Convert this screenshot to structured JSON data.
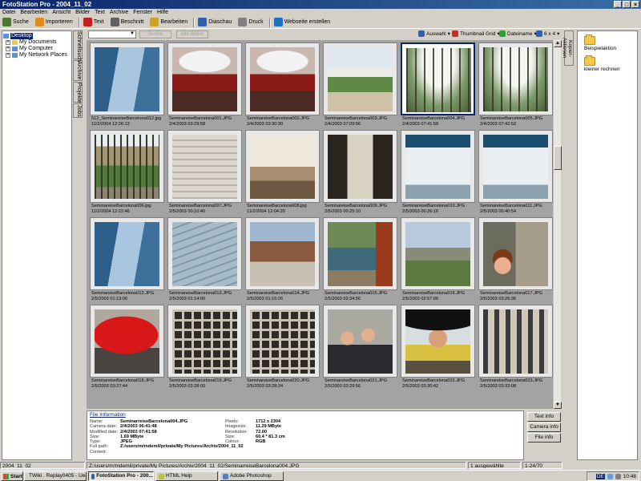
{
  "window": {
    "title": "FotoStation Pro - 2004_11_02",
    "controls": [
      "_",
      "□",
      "×"
    ]
  },
  "menu": [
    "Datei",
    "Bearbeiten",
    "Ansicht",
    "Bilder",
    "Text",
    "Archive",
    "Fenster",
    "Hilfe"
  ],
  "toolbar": [
    {
      "label": "Suche",
      "icon": "search-icon",
      "color": "#4a7a30"
    },
    {
      "label": "Importeren",
      "icon": "import-icon",
      "color": "#e08a20"
    },
    {
      "label": "Text",
      "icon": "text-edit-icon",
      "color": "#c02020"
    },
    {
      "label": "Beschnitt",
      "icon": "crop-icon",
      "color": "#606060"
    },
    {
      "label": "Bearbeiten",
      "icon": "edit-icon",
      "color": "#d0a020"
    },
    {
      "label": "Diaschau",
      "icon": "slideshow-icon",
      "color": "#3060b0"
    },
    {
      "label": "Druck",
      "icon": "print-icon",
      "color": "#808080"
    },
    {
      "label": "Webseite erstellen",
      "icon": "globe-icon",
      "color": "#2070c0"
    }
  ],
  "tree": [
    {
      "label": "Desktop",
      "selected": true,
      "expander": ""
    },
    {
      "label": "My Documents",
      "selected": false,
      "expander": "+"
    },
    {
      "label": "My Computer",
      "selected": false,
      "expander": "+"
    },
    {
      "label": "My Network Places",
      "selected": false,
      "expander": "+"
    }
  ],
  "left_tabs": [
    "Schnellsuch",
    "Archive",
    "Projekte",
    "Jobs"
  ],
  "filter": {
    "search_button": "Suche",
    "all_button": "alle Bilder",
    "selection_label": "Auswahl",
    "view_label": "Thumbnail Grid",
    "sort_label": "Dateiname",
    "grid_size": "6 x 4"
  },
  "thumbnails": [
    {
      "name": "512_SeminareiseBarcelona012.jpg",
      "date": "11/2/2004 12:26:12",
      "scene": "corridor"
    },
    {
      "name": "SeminareiseBarcelona001.JPG",
      "date": "2/4/2003 03:29:58",
      "scene": "redinterior"
    },
    {
      "name": "SeminareiseBarcelona002.JPG",
      "date": "2/4/2003 03:30:30",
      "scene": "redinterior"
    },
    {
      "name": "SeminareiseBarcelona003.JPG",
      "date": "2/4/2003 07:09:56",
      "scene": "courtyard"
    },
    {
      "name": "SeminareiseBarcelona004.JPG",
      "date": "2/4/2003 07:41:58",
      "scene": "greenhouse",
      "selected": true
    },
    {
      "name": "SeminareiseBarcelona005.JPG",
      "date": "2/4/2003 07:42:52",
      "scene": "greenhouse"
    },
    {
      "name": "SeminareiseBarcelona006.jpg",
      "date": "11/2/2004 12:22:46",
      "scene": "pergola"
    },
    {
      "name": "SeminareiseBarcelona007.JPG",
      "date": "2/5/2003 00:10:40",
      "scene": "stairs"
    },
    {
      "name": "SeminareiseBarcelona008.jpg",
      "date": "11/2/2004 12:04:20",
      "scene": "room"
    },
    {
      "name": "SeminareiseBarcelona009.JPG",
      "date": "2/5/2003 00:25:10",
      "scene": "lobby"
    },
    {
      "name": "SeminareiseBarcelona010.JPG",
      "date": "2/5/2003 00:26:16",
      "scene": "glass"
    },
    {
      "name": "SeminareiseBarcelona011.JPG",
      "date": "2/5/2003 00:40:54",
      "scene": "glass"
    },
    {
      "name": "SeminareiseBarcelona012.JPG",
      "date": "2/5/2003 01:13:06",
      "scene": "corridor"
    },
    {
      "name": "SeminareiseBarcelona013.JPG",
      "date": "2/5/2003 01:14:00",
      "scene": "concrete"
    },
    {
      "name": "SeminareiseBarcelona014.JPG",
      "date": "2/5/2003 01:16:26",
      "scene": "brick"
    },
    {
      "name": "SeminareiseBarcelona015.JPG",
      "date": "2/5/2003 02:34:56",
      "scene": "pond"
    },
    {
      "name": "SeminareiseBarcelona016.JPG",
      "date": "2/5/2003 02:57:06",
      "scene": "city"
    },
    {
      "name": "SeminareiseBarcelona017.JPG",
      "date": "2/5/2003 03:26:36",
      "scene": "woman"
    },
    {
      "name": "SeminareiseBarcelona018.JPG",
      "date": "2/5/2003 03:27:44",
      "scene": "umbrella"
    },
    {
      "name": "SeminareiseBarcelona019.JPG",
      "date": "2/5/2003 03:28:00",
      "scene": "niches"
    },
    {
      "name": "SeminareiseBarcelona020.JPG",
      "date": "2/5/2003 03:28:24",
      "scene": "niches"
    },
    {
      "name": "SeminareiseBarcelona021.JPG",
      "date": "2/5/2003 03:29:56",
      "scene": "people"
    },
    {
      "name": "SeminareiseBarcelona022.JPG",
      "date": "2/5/2003 03:30:42",
      "scene": "umbrellaman"
    },
    {
      "name": "SeminareiseBarcelona023.JPG",
      "date": "2/5/2003 03:33:08",
      "scene": "crowd"
    }
  ],
  "actions_tab": "Kopier-Aktionen",
  "actions": [
    {
      "label": "Beispielaktion",
      "icon": "folder-icon"
    },
    {
      "label": "kleiner rechnen",
      "icon": "folder-icon"
    }
  ],
  "file_info": {
    "title": "File Information",
    "left": [
      {
        "k": "Name:",
        "v": "SeminarreiseBarcelona004.JPG"
      },
      {
        "k": "Camera date:",
        "v": "2/4/2003 06:41:48"
      },
      {
        "k": "Modified date:",
        "v": "2/4/2003 07:41:58"
      },
      {
        "k": "Size:",
        "v": "1.69 MByte"
      },
      {
        "k": "Type:",
        "v": "JPEG"
      },
      {
        "k": "Full path:",
        "v": "Z:/users/m/mdemil/private/My Pictures/Archiv/2004_11_02"
      },
      {
        "k": "Content:",
        "v": ""
      }
    ],
    "right": [
      {
        "k": "Pixels:",
        "v": "1712 x 2304"
      },
      {
        "k": "Imagesize:",
        "v": "11.29 MByte"
      },
      {
        "k": "Resolution:",
        "v": "72.00"
      },
      {
        "k": "Size:",
        "v": "60.4 * 81.3 cm"
      },
      {
        "k": "Colour:",
        "v": "RGB"
      }
    ],
    "buttons": [
      "Text info",
      "Camera info",
      "File info"
    ]
  },
  "status": {
    "folder": "2004_11_02",
    "path": "Z:/users/m/mdemil/private/My Pictures/Archiv/2004_11_02/SeminarreiseBarcelona004.JPG",
    "selected": "1 ausgewählte",
    "range": "1-24/70"
  },
  "taskbar": {
    "start": "Start",
    "tasks": [
      {
        "label": "TWiki . Replay0405 - Uebe...",
        "active": false
      },
      {
        "label": "FotoStation Pro - 200...",
        "active": true
      },
      {
        "label": "HTML Help",
        "active": false
      },
      {
        "label": "Adobe Photoshop",
        "active": false
      }
    ],
    "lang": "DE",
    "time": "10:48"
  }
}
